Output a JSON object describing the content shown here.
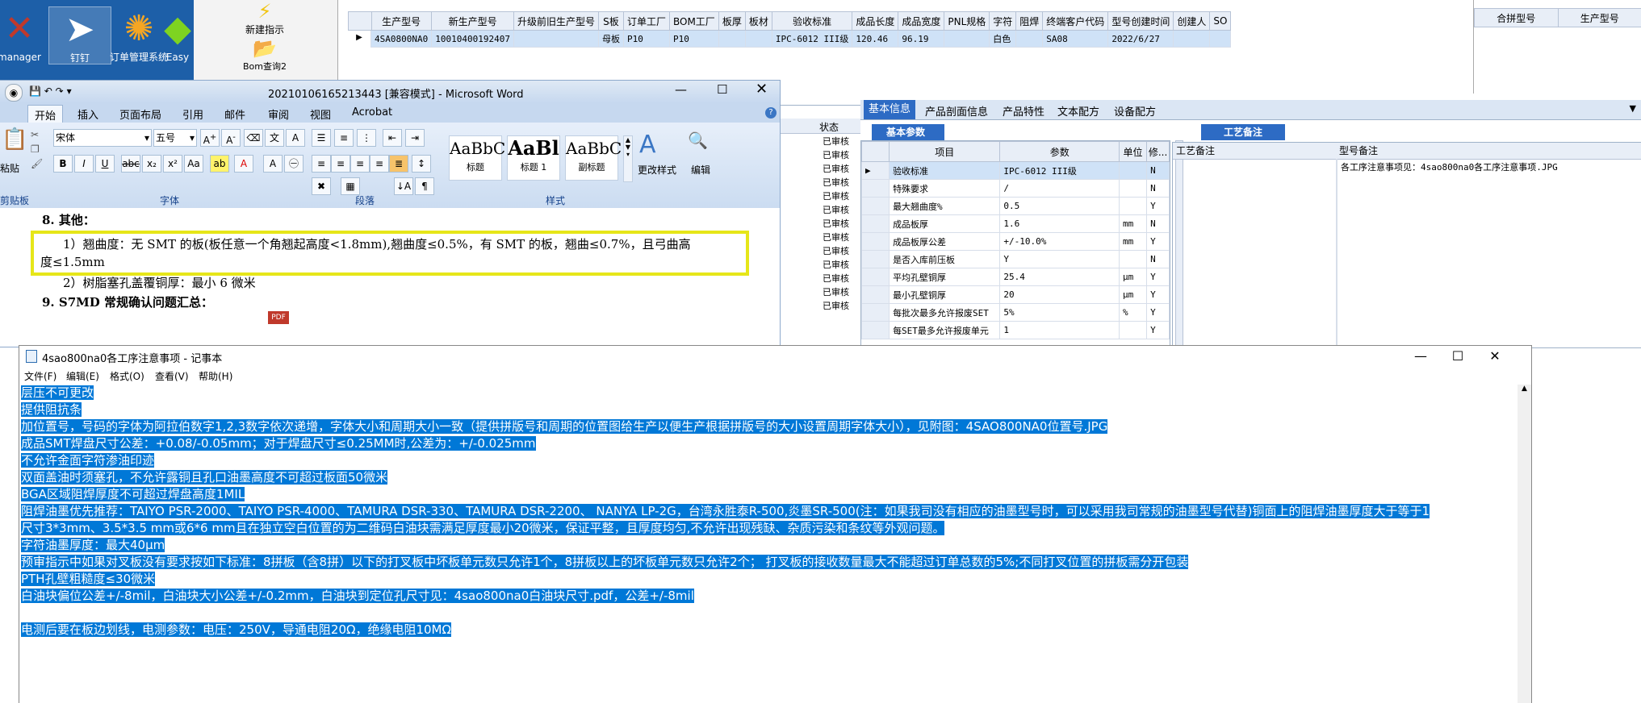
{
  "desktop": {
    "icons": [
      {
        "label": "manager",
        "glyph": "✕",
        "icon": "xmanager-icon"
      },
      {
        "label": "钉钉",
        "glyph": "➤",
        "icon": "dingtalk-icon"
      },
      {
        "label": "订单管理系统",
        "glyph": "✺",
        "icon": "order-system-icon"
      },
      {
        "label": "Easy",
        "glyph": "◆",
        "icon": "easy-icon"
      }
    ]
  },
  "erp": {
    "tool_new": "新建指示",
    "tool_bom": "Bom查询2",
    "grid_top_columns": [
      "生产型号",
      "新生产型号",
      "升级前旧生产型号",
      "S板",
      "订单工厂",
      "BOM工厂",
      "板厚",
      "板材",
      "验收标准",
      "成品长度",
      "成品宽度",
      "PNL规格",
      "字符",
      "阻焊",
      "终端客户代码",
      "型号创建时间",
      "创建人",
      "SO"
    ],
    "grid_top_row": [
      "4SA0800NA0",
      "10010400192407",
      "",
      "母板",
      "P10",
      "P10",
      "",
      "",
      "IPC-6012 III级",
      "120.46",
      "96.19",
      "",
      "白色",
      "",
      "SA08",
      "2022/6/27",
      "",
      ""
    ],
    "right_columns": [
      "合拼型号",
      "生产型号"
    ],
    "status_header": "状态",
    "status_values": [
      "已审核",
      "已审核",
      "已审核",
      "已审核",
      "已审核",
      "已审核",
      "已审核",
      "已审核",
      "已审核",
      "已审核",
      "已审核",
      "已审核",
      "已审核"
    ],
    "info_tabs": [
      "基本信息",
      "产品剖面信息",
      "产品特性",
      "文本配方",
      "设备配方"
    ],
    "basic_params_tab": "基本参数",
    "process_notes_tab": "工艺备注",
    "param_columns": [
      "项目",
      "参数",
      "单位",
      "修..."
    ],
    "params": [
      {
        "item": "验收标准",
        "value": "IPC-6012 III级",
        "unit": "",
        "flag": "N"
      },
      {
        "item": "特殊要求",
        "value": "/",
        "unit": "",
        "flag": "N"
      },
      {
        "item": "最大翘曲度%",
        "value": "0.5",
        "unit": "",
        "flag": "Y"
      },
      {
        "item": "成品板厚",
        "value": "1.6",
        "unit": "mm",
        "flag": "N"
      },
      {
        "item": "成品板厚公差",
        "value": "+/-10.0%",
        "unit": "mm",
        "flag": "Y"
      },
      {
        "item": "是否入库前压板",
        "value": "Y",
        "unit": "",
        "flag": "N"
      },
      {
        "item": "平均孔壁铜厚",
        "value": "25.4",
        "unit": "μm",
        "flag": "Y"
      },
      {
        "item": "最小孔壁铜厚",
        "value": "20",
        "unit": "μm",
        "flag": "Y"
      },
      {
        "item": "每批次最多允许报废SET",
        "value": "5%",
        "unit": "%",
        "flag": "Y"
      },
      {
        "item": "每SET最多允许报废单元",
        "value": "1",
        "unit": "",
        "flag": "Y"
      }
    ],
    "notes_columns": [
      "工艺备注",
      "型号备注"
    ],
    "model_note": "各工序注意事项见：4sao800na0各工序注意事项.JPG"
  },
  "word": {
    "title": "20210106165213443 [兼容模式] - Microsoft Word",
    "tabs": [
      "开始",
      "插入",
      "页面布局",
      "引用",
      "邮件",
      "审阅",
      "视图",
      "Acrobat"
    ],
    "font_name": "宋体",
    "font_size": "五号",
    "group_labels": [
      "剪贴板",
      "字体",
      "段落",
      "样式",
      "编辑"
    ],
    "paste_label": "粘贴",
    "styles": [
      {
        "sample": "AaBbC",
        "name": "标题"
      },
      {
        "sample": "AaBl",
        "name": "标题 1"
      },
      {
        "sample": "AaBbC",
        "name": "副标题"
      }
    ],
    "change_styles": "更改样式",
    "edit_label": "编辑",
    "doc_heading8": "8.    其他：",
    "doc_line1a": "1）翘曲度：无 SMT 的板(板任意一个角翘起高度<1.8mm),翘曲度≤0.5%，有 SMT 的板，翘曲≤0.7%，且弓曲高",
    "doc_line1b": "度≤1.5mm",
    "doc_line2": "2）树脂塞孔盖覆铜厚：最小 6 微米",
    "doc_heading9": "9.    S7MD 常规确认问题汇总：",
    "pdf_icon_label": "PDF"
  },
  "notepad": {
    "title": "4sao800na0各工序注意事项 - 记事本",
    "menu": [
      "文件(F)",
      "编辑(E)",
      "格式(O)",
      "查看(V)",
      "帮助(H)"
    ],
    "lines": [
      "层压不可更改",
      "提供阻抗条",
      "加位置号，号码的字体为阿拉伯数字1,2,3数字依次递增，字体大小和周期大小一致（提供拼版号和周期的位置图给生产以便生产根据拼版号的大小设置周期字体大小），见附图：4SAO800NA0位置号.JPG",
      "成品SMT焊盘尺寸公差：+0.08/-0.05mm；对于焊盘尺寸≤0.25MM时,公差为：+/-0.025mm",
      "不允许金面字符渗油印迹",
      "双面盖油时须塞孔，不允许露铜且孔口油墨高度不可超过板面50微米",
      "BGA区域阻焊厚度不可超过焊盘高度1MIL",
      "阻焊油墨优先推荐：TAIYO PSR-2000、TAIYO PSR-4000、TAMURA  DSR-330、TAMURA DSR-2200、 NANYA LP-2G，台湾永胜泰R-500,炎墨SR-500(注：如果我司没有相应的油墨型号时，可以采用我司常规的油墨型号代替)铜面上的阻焊油墨厚度大于等于1",
      "尺寸3*3mm、3.5*3.5 mm或6*6 mm且在独立空白位置的为二维码白油块需满足厚度最小20微米，保证平整，且厚度均匀,不允许出现残缺、杂质污染和条纹等外观问题。",
      "字符油墨厚度：最大40μm",
      "预审指示中如果对叉板没有要求按如下标准：8拼板（含8拼）以下的打叉板中坏板单元数只允许1个，8拼板以上的坏板单元数只允许2个；  打叉板的接收数量最大不能超过订单总数的5%;不同打叉位置的拼板需分开包装",
      "PTH孔壁粗糙度≤30微米",
      "白油块偏位公差+/-8mil，白油块大小公差+/-0.2mm，白油块到定位孔尺寸见：4sao800na0白油块尺寸.pdf，公差+/-8mil",
      "",
      "电测后要在板边划线，电测参数：电压：250V，导通电阻20Ω，绝缘电阻10MΩ"
    ]
  },
  "colors": {
    "selection": "#0078d7",
    "highlight_box": "#e6e619",
    "desktop": "#1d5fa8"
  }
}
